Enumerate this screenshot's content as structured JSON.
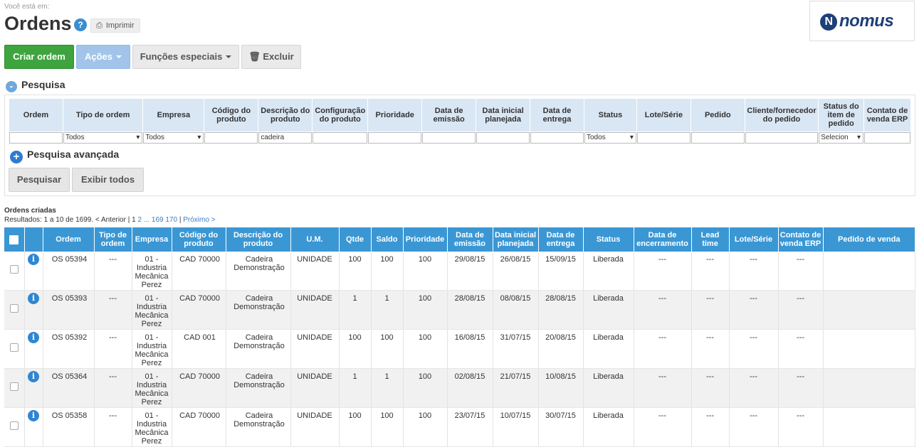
{
  "breadcrumb": "Você está em:",
  "title": "Ordens",
  "help_icon": "?",
  "print_label": "Imprimir",
  "logo_text": "nomus",
  "toolbar": {
    "create": "Criar ordem",
    "actions": "Ações",
    "special": "Funções especiais",
    "delete": "Excluir"
  },
  "search": {
    "title": "Pesquisa",
    "advanced": "Pesquisa avançada",
    "search_button": "Pesquisar",
    "show_all_button": "Exibir todos",
    "headers": [
      "Ordem",
      "Tipo de ordem",
      "Empresa",
      "Código do produto",
      "Descrição do produto",
      "Configuração do produto",
      "Prioridade",
      "Data de emissão",
      "Data inicial planejada",
      "Data de entrega",
      "Status",
      "Lote/Série",
      "Pedido",
      "Cliente/fornecedor do pedido",
      "Status do item de pedido",
      "Contato de venda ERP"
    ],
    "values": {
      "tipo_ordem": "Todos",
      "empresa": "Todos",
      "descricao": "cadeira",
      "status": "Todos",
      "status_item": "Selecion"
    }
  },
  "orders": {
    "title": "Ordens criadas",
    "results_prefix": "Resultados: 1 a 10 de 1699. < Anterior | ",
    "current_page": "1",
    "page_links": "2 ... 169 170",
    "next": "Próximo >",
    "separator": " | ",
    "columns": [
      "Ordem",
      "Tipo de ordem",
      "Empresa",
      "Código do produto",
      "Descrição do produto",
      "U.M.",
      "Qtde",
      "Saldo",
      "Prioridade",
      "Data de emissão",
      "Data inicial planejada",
      "Data de entrega",
      "Status",
      "Data de encerramento",
      "Lead time",
      "Lote/Série",
      "Contato de venda ERP",
      "Pedido de venda"
    ],
    "rows": [
      {
        "ordem": "OS 05394",
        "tipo": "---",
        "empresa": "01 - Industria Mecânica Perez",
        "codigo": "CAD 70000",
        "descricao": "Cadeira Demonstração",
        "um": "UNIDADE",
        "qtde": "100",
        "saldo": "100",
        "prioridade": "100",
        "emissao": "29/08/15",
        "inicial": "26/08/15",
        "entrega": "15/09/15",
        "status": "Liberada",
        "encerramento": "---",
        "lead": "---",
        "lote": "---",
        "contato": "---",
        "pedido": ""
      },
      {
        "ordem": "OS 05393",
        "tipo": "---",
        "empresa": "01 - Industria Mecânica Perez",
        "codigo": "CAD 70000",
        "descricao": "Cadeira Demonstração",
        "um": "UNIDADE",
        "qtde": "1",
        "saldo": "1",
        "prioridade": "100",
        "emissao": "28/08/15",
        "inicial": "08/08/15",
        "entrega": "28/08/15",
        "status": "Liberada",
        "encerramento": "---",
        "lead": "---",
        "lote": "---",
        "contato": "---",
        "pedido": ""
      },
      {
        "ordem": "OS 05392",
        "tipo": "---",
        "empresa": "01 - Industria Mecânica Perez",
        "codigo": "CAD 001",
        "descricao": "Cadeira Demonstração",
        "um": "UNIDADE",
        "qtde": "100",
        "saldo": "100",
        "prioridade": "100",
        "emissao": "16/08/15",
        "inicial": "31/07/15",
        "entrega": "20/08/15",
        "status": "Liberada",
        "encerramento": "---",
        "lead": "---",
        "lote": "---",
        "contato": "---",
        "pedido": ""
      },
      {
        "ordem": "OS 05364",
        "tipo": "---",
        "empresa": "01 - Industria Mecânica Perez",
        "codigo": "CAD 70000",
        "descricao": "Cadeira Demonstração",
        "um": "UNIDADE",
        "qtde": "1",
        "saldo": "1",
        "prioridade": "100",
        "emissao": "02/08/15",
        "inicial": "21/07/15",
        "entrega": "10/08/15",
        "status": "Liberada",
        "encerramento": "---",
        "lead": "---",
        "lote": "---",
        "contato": "---",
        "pedido": ""
      },
      {
        "ordem": "OS 05358",
        "tipo": "---",
        "empresa": "01 - Industria Mecânica Perez",
        "codigo": "CAD 70000",
        "descricao": "Cadeira Demonstração",
        "um": "UNIDADE",
        "qtde": "100",
        "saldo": "100",
        "prioridade": "100",
        "emissao": "23/07/15",
        "inicial": "10/07/15",
        "entrega": "30/07/15",
        "status": "Liberada",
        "encerramento": "---",
        "lead": "---",
        "lote": "---",
        "contato": "---",
        "pedido": ""
      }
    ]
  },
  "colors": {
    "create_button": "#3ea43e",
    "actions_button": "#a2c4ea",
    "grid_header": "#3a97d4",
    "filter_header": "#d9e6f4",
    "logo": "#1d3f7a"
  }
}
